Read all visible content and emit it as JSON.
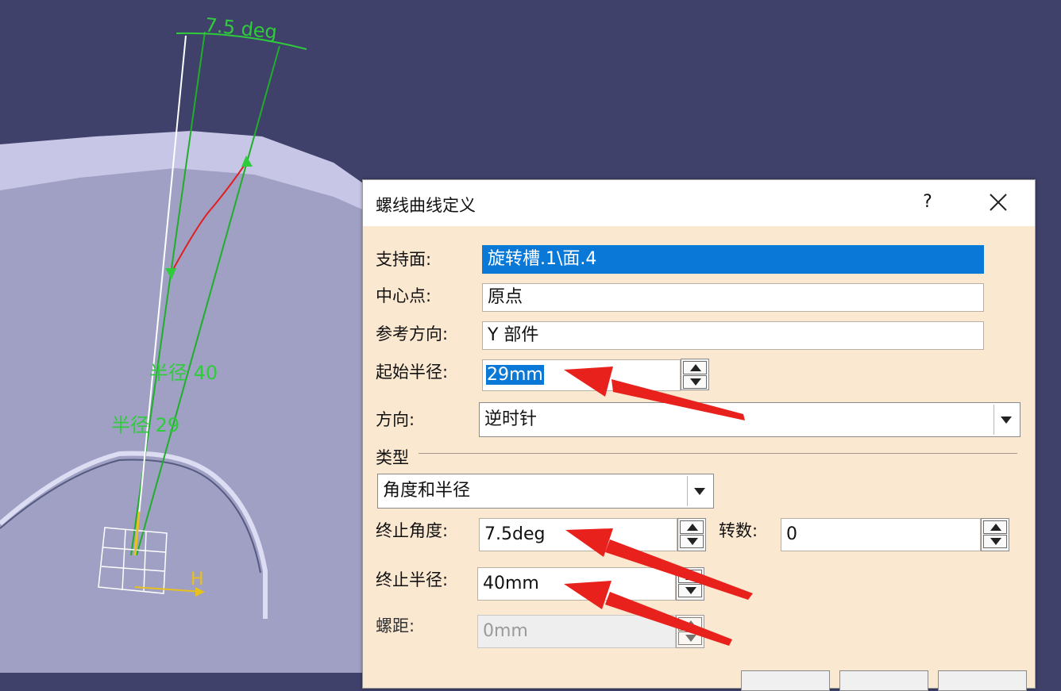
{
  "viewport": {
    "dimension_angle": "7.5 deg",
    "label_radius_40": "半径 40",
    "label_radius_29": "半径 29",
    "axis_label_h": "H",
    "colors": {
      "background": "#3f416a",
      "dimension": "#2ecc3a",
      "curve": "#e02020",
      "part": "#b7b6d8"
    }
  },
  "dialog": {
    "title": "螺线曲线定义",
    "help": "?",
    "fields": {
      "support_label": "支持面:",
      "support_value": "旋转槽.1\\面.4",
      "center_label": "中心点:",
      "center_value": "原点",
      "refdir_label": "参考方向:",
      "refdir_value": "Y 部件",
      "start_radius_label": "起始半径:",
      "start_radius_value": "29mm",
      "orientation_label": "方向:",
      "orientation_value": "逆时针"
    },
    "type_group": {
      "label": "类型",
      "type_value": "角度和半径",
      "end_angle_label": "终止角度:",
      "end_angle_value": "7.5deg",
      "revolutions_label": "转数:",
      "revolutions_value": "0",
      "end_radius_label": "终止半径:",
      "end_radius_value": "40mm",
      "pitch_label": "螺距:",
      "pitch_value": "0mm"
    },
    "colors": {
      "panel": "#fbe8d1",
      "selection": "#0a78d7",
      "annotation_arrow": "#e8211c"
    }
  }
}
